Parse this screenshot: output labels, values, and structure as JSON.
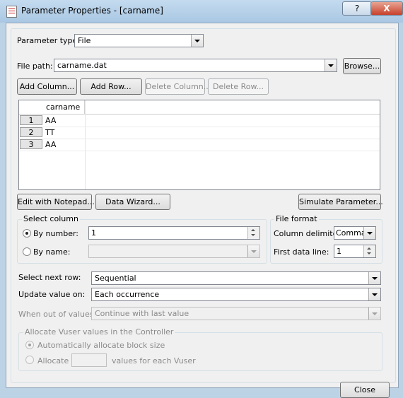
{
  "window": {
    "title": "Parameter Properties - [carname]",
    "help_label": "?",
    "close_label": "X"
  },
  "param_type": {
    "label": "Parameter type:",
    "value": "File"
  },
  "file_path": {
    "label": "File path:",
    "value": "carname.dat",
    "browse_label": "Browse..."
  },
  "toolbar": {
    "add_column": "Add Column...",
    "add_row": "Add Row...",
    "delete_column": "Delete Column...",
    "delete_row": "Delete Row..."
  },
  "grid": {
    "column_header": "carname",
    "rows": [
      {
        "num": "1",
        "value": "AA"
      },
      {
        "num": "2",
        "value": "TT"
      },
      {
        "num": "3",
        "value": "AA"
      }
    ]
  },
  "actions": {
    "edit_notepad": "Edit with Notepad...",
    "data_wizard": "Data Wizard...",
    "simulate": "Simulate Parameter..."
  },
  "select_column": {
    "title": "Select column",
    "by_number_label": "By number:",
    "by_number_value": "1",
    "by_name_label": "By name:",
    "by_name_value": ""
  },
  "file_format": {
    "title": "File format",
    "delimiter_label": "Column delimiter:",
    "delimiter_value": "Comma",
    "first_line_label": "First data line:",
    "first_line_value": "1"
  },
  "select_next_row": {
    "label": "Select next row:",
    "value": "Sequential"
  },
  "update_value": {
    "label": "Update value on:",
    "value": "Each occurrence"
  },
  "out_of_values": {
    "label": "When out of values:",
    "value": "Continue with last value"
  },
  "allocate": {
    "title": "Allocate Vuser values in the Controller",
    "auto_label": "Automatically allocate block size",
    "allocate_label": "Allocate",
    "allocate_value": "",
    "suffix_label": "values for each Vuser"
  },
  "footer": {
    "close_label": "Close"
  }
}
